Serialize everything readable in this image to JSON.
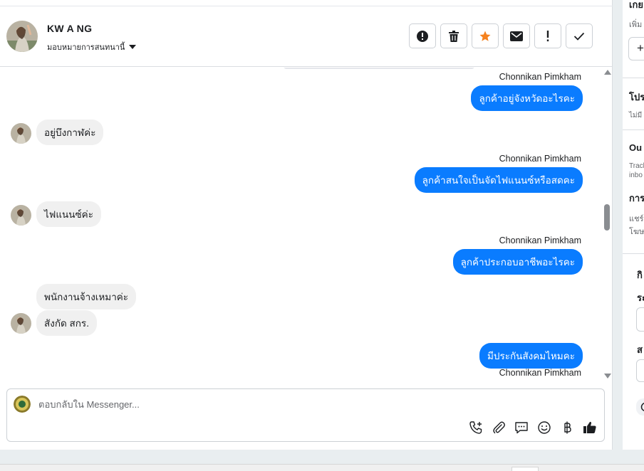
{
  "header": {
    "contact_name": "KW A NG",
    "assign_label": "มอบหมายการสนทนานี้"
  },
  "actions": [
    {
      "icon": "alert-circle-icon",
      "label": "spam"
    },
    {
      "icon": "trash-icon",
      "label": "delete"
    },
    {
      "icon": "star-icon",
      "label": "star"
    },
    {
      "icon": "mail-icon",
      "label": "mark unread"
    },
    {
      "icon": "exclamation-icon",
      "label": "follow up"
    },
    {
      "icon": "check-icon",
      "label": "done"
    }
  ],
  "messages": [
    {
      "sender": "Chonnikan Pimkham",
      "text": "ลูกค้าอยู่จังหวัดอะไรคะ"
    },
    {
      "text": "อยู่บึงกาฬค่ะ"
    },
    {
      "sender": "Chonnikan Pimkham",
      "text": "ลูกค้าสนใจเป็นจัดไฟแนนซ์หรือสดคะ"
    },
    {
      "text": "ไฟแนนซ์ค่ะ"
    },
    {
      "sender": "Chonnikan Pimkham",
      "text": "ลูกค้าประกอบอาชีพอะไรคะ"
    },
    {
      "text": "พนักงานจ้างเหมาค่ะ"
    },
    {
      "text": "สังกัด สกร."
    },
    {
      "sender": "Chonnikan Pimkham",
      "text": "มีประกันสังคมไหมคะ"
    }
  ],
  "composer": {
    "placeholder": "ตอบกลับใน Messenger..."
  },
  "right_panel": {
    "t1": "เกย",
    "t2": "เพิ่ม",
    "t3": "โปร",
    "t4": "ไม่มี",
    "t5": "Ou",
    "t6": "Track",
    "t7": "inbo",
    "t8": "การ",
    "t9": "แชร์",
    "t10": "โฆษ",
    "t11": "กิ",
    "t12": "ระ",
    "t13": "ส",
    "plus": "+"
  },
  "colors": {
    "outgoing_bubble": "#0a7cff",
    "incoming_bubble": "#f0f0f0",
    "star": "#f5821f"
  }
}
